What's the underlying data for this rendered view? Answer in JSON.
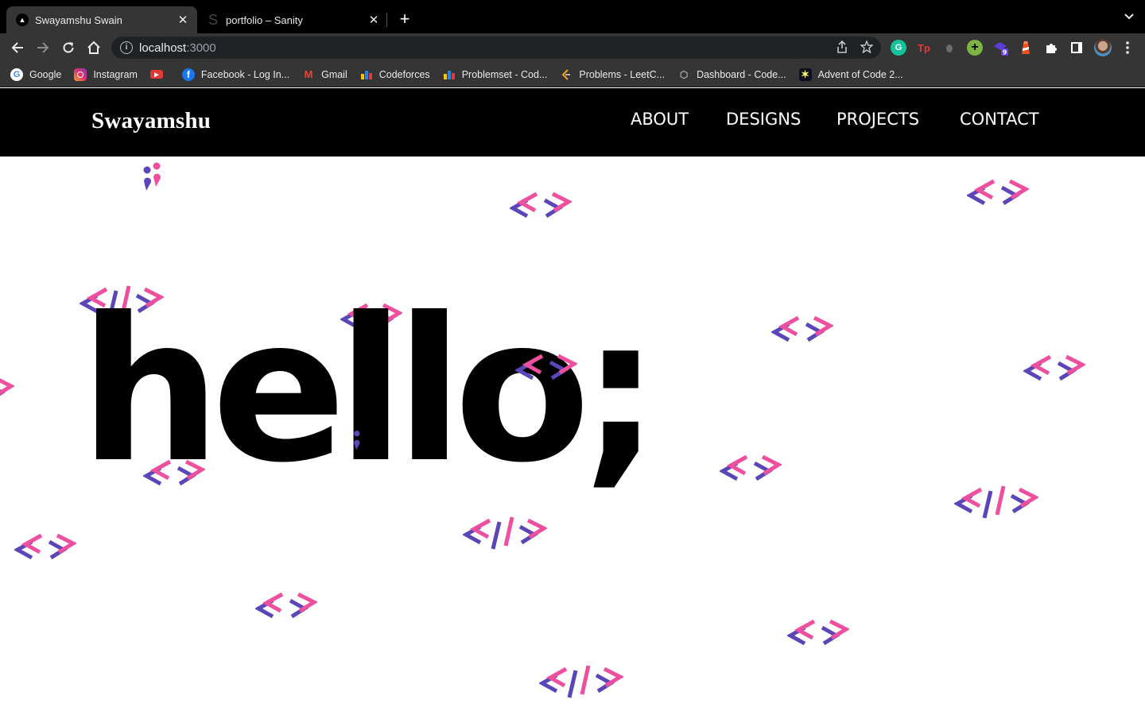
{
  "browser": {
    "tabs": [
      {
        "title": "Swayamshu Swain",
        "active": true,
        "favicon": "vercel-triangle-icon"
      },
      {
        "title": "portfolio – Sanity",
        "active": false,
        "favicon": "sanity-s-icon"
      }
    ],
    "new_tab_label": "+",
    "close_label": "✕",
    "address": {
      "host": "localhost",
      "port": ":3000"
    },
    "bookmarks": [
      {
        "label": "Google",
        "icon": "google-icon"
      },
      {
        "label": "Instagram",
        "icon": "instagram-icon"
      },
      {
        "label": "",
        "icon": "youtube-icon"
      },
      {
        "label": "Facebook - Log In...",
        "icon": "facebook-icon"
      },
      {
        "label": "Gmail",
        "icon": "gmail-icon"
      },
      {
        "label": "Codeforces",
        "icon": "codeforces-icon"
      },
      {
        "label": "Problemset - Cod...",
        "icon": "codeforces-icon"
      },
      {
        "label": "Problems - LeetC...",
        "icon": "leetcode-icon"
      },
      {
        "label": "Dashboard - Code...",
        "icon": "codechef-icon"
      },
      {
        "label": "Advent of Code 2...",
        "icon": "advent-star-icon"
      }
    ],
    "extensions": [
      {
        "name": "grammarly-icon",
        "glyph": "G",
        "color": "#15c39a"
      },
      {
        "name": "tp-icon",
        "glyph": "Tp",
        "color": "#e53935"
      },
      {
        "name": "bug-icon",
        "glyph": "●",
        "color": "#6b6b6b"
      },
      {
        "name": "plus-circle-icon",
        "glyph": "+",
        "color": "#7cb342"
      },
      {
        "name": "stack-icon",
        "glyph": "◆",
        "color": "#5c3dd8",
        "badge": "9"
      },
      {
        "name": "lighthouse-icon",
        "glyph": "▲",
        "color": "#f4511e"
      },
      {
        "name": "puzzle-icon",
        "glyph": "✚",
        "color": "#ffffff"
      },
      {
        "name": "sidepanel-icon",
        "glyph": "▯",
        "color": "#ffffff"
      }
    ]
  },
  "site": {
    "logo": "Swayamshu",
    "nav": [
      "ABOUT",
      "DESIGNS",
      "PROJECTS",
      "CONTACT"
    ],
    "hero_text": "hello;",
    "colors": {
      "purple": "#5b45b8",
      "pink": "#ef4f9f",
      "header_bg": "#000000"
    }
  }
}
